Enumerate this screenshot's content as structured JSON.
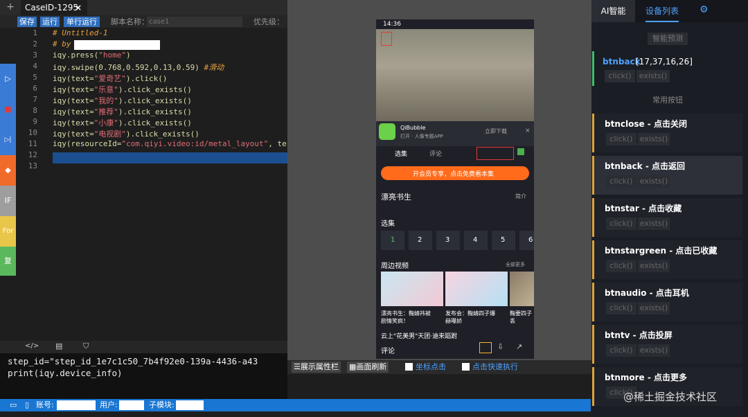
{
  "editor": {
    "tab_add": "+",
    "tab_title": "CaseID-1295",
    "tab_close": "×",
    "toolbar": {
      "save": "保存",
      "run": "运行",
      "run_single": "单行运行",
      "script_name_label": "脚本名称：",
      "script_name_value": "case1",
      "priority_label": "优先级："
    },
    "left_tools": [
      "▷",
      "■",
      "▷|",
      "◆",
      "IF",
      "For",
      "复"
    ],
    "line_numbers": [
      "1",
      "2",
      "3",
      "4",
      "5",
      "6",
      "7",
      "8",
      "9",
      "10",
      "11",
      "12",
      "13"
    ],
    "lines": {
      "l1": "# Untitled-1",
      "l2": "# by",
      "l3a": "iqy.press(",
      "l3b": "\"home\"",
      "l3c": ")",
      "l4a": "iqy.swipe(0.768,0.592,0.13,0.59) ",
      "l4b": "#滑动",
      "l5a": "iqy(text=",
      "l5b": "\"爱奇艺\"",
      "l5c": ").click()",
      "l6a": "iqy(text=",
      "l6b": "\"乐意\"",
      "l6c": ").click_exists()",
      "l7a": "iqy(text=",
      "l7b": "\"我的\"",
      "l7c": ").click_exists()",
      "l8a": "iqy(text=",
      "l8b": "\"推荐\"",
      "l8c": ").click_exists()",
      "l9a": "iqy(text=",
      "l9b": "\"小康\"",
      "l9c": ").click_exists()",
      "l10a": "iqy(text=",
      "l10b": "\"电视剧\"",
      "l10c": ").click_exists()",
      "l11a": "iqy(resourceId=",
      "l11b": "\"com.qiyi.video:id/metal_layout\"",
      "l11c": ", te"
    },
    "console_icons": [
      "</>",
      "▤",
      "⛉"
    ],
    "console_lines": [
      "step_id=\"step_id_1e7c1c50_7b4f92e0-139a-4436-a43",
      "print(iqy.device_info)"
    ]
  },
  "statusbar": {
    "account": "账号:",
    "user": "用户:",
    "module": "子模块:"
  },
  "device": {
    "time": "14:36",
    "popup_title": "QiBubble",
    "popup_sub": "打开 · 人像专题APP",
    "popup_btn": "立即下载",
    "tab_select": "选集",
    "tab_comment": "评论",
    "vip_banner": "开会员专享，点击免费看本集",
    "show_title": "漂亮书生",
    "show_more": "简介",
    "episodes_label": "选集",
    "episodes": [
      "1",
      "2",
      "3",
      "4",
      "5",
      "6"
    ],
    "nearby": "周边视频",
    "nearby_more": "全部更多",
    "thumb_captions": [
      "漂亮书生：鞠婧祎被\n剧情笑疯！",
      "发布会：鞠婧四子爆\n赫曝娇",
      "鞠要四子\n丢"
    ],
    "bottom_text": "云上\"花美男\"天团·迪来蹈跗",
    "comment": "评论",
    "toolbar": {
      "show_props": "展示属性栏",
      "refresh": "画面刷新",
      "coord_click": "坐标点击",
      "fast_click": "点击快速执行"
    }
  },
  "panel": {
    "tab_ai": "AI智能",
    "tab_devices": "设备列表",
    "smart_btn": "智能预测",
    "selected": {
      "name": "btnback",
      "coords": "[17,37,16,26]"
    },
    "common_label": "常用按钮",
    "click": "click()",
    "exists": "exists()",
    "buttons": [
      "btnclose - 点击关闭",
      "btnback - 点击返回",
      "btnstar - 点击收藏",
      "btnstargreen - 点击已收藏",
      "btnaudio - 点击耳机",
      "btntv - 点击投屏",
      "btnmore - 点击更多"
    ]
  },
  "watermark": "@稀土掘金技术社区"
}
